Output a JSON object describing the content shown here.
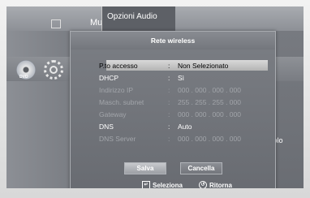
{
  "background_menu": {
    "music_label": "Musica",
    "header_title": "Opzioni Audio",
    "dvd_label": "DVD",
    "partial_text": "solo"
  },
  "dialog": {
    "title": "Rete wireless",
    "rows": [
      {
        "label": "P.to accesso",
        "sep": ":",
        "value": "Non Selezionato",
        "state": "selected"
      },
      {
        "label": "DHCP",
        "sep": ":",
        "value": "Sì",
        "state": "active"
      },
      {
        "label": "Indirizzo IP",
        "sep": ":",
        "value": "000 . 000 . 000 . 000",
        "state": "dim"
      },
      {
        "label": "Masch. subnet",
        "sep": ":",
        "value": "255 . 255 . 255 . 000",
        "state": "dim"
      },
      {
        "label": "Gateway",
        "sep": ":",
        "value": "000 . 000 . 000 . 000",
        "state": "dim"
      },
      {
        "label": "DNS",
        "sep": ":",
        "value": "Auto",
        "state": "active"
      },
      {
        "label": "DNS Server",
        "sep": ":",
        "value": "000 . 000 . 000 . 000",
        "state": "dim"
      }
    ],
    "save_label": "Salva",
    "cancel_label": "Cancella",
    "select_hint": "Seleziona",
    "return_hint": "Ritorna"
  },
  "colors": {
    "dialog_bg": "#74777d",
    "selection": "#c9c9c9",
    "active_text": "#ffffff",
    "dim_text": "#a2a5aa"
  }
}
